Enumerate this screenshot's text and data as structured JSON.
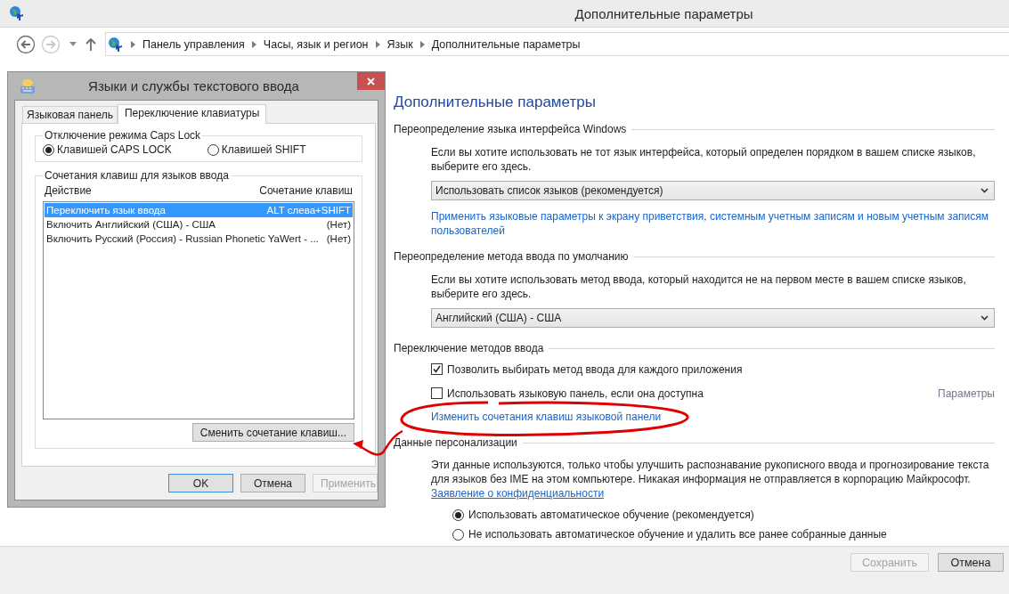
{
  "window": {
    "title": "Дополнительные параметры"
  },
  "nav": [
    {
      "kind": "back",
      "disabled": false
    },
    {
      "kind": "forward",
      "disabled": true
    },
    {
      "kind": "history"
    },
    {
      "kind": "up"
    }
  ],
  "breadcrumb": [
    "Панель управления",
    "Часы, язык и регион",
    "Язык",
    "Дополнительные параметры"
  ],
  "content": {
    "heading": "Дополнительные параметры",
    "sections": [
      {
        "title": "Переопределение языка интерфейса Windows",
        "items": [
          {
            "kind": "text",
            "text": "Если вы хотите использовать не тот язык интерфейса, который определен порядком в вашем списке языков, выберите его здесь."
          },
          {
            "kind": "select",
            "value": "Использовать список языков (рекомендуется)"
          },
          {
            "kind": "link",
            "text": "Применить языковые параметры к экрану приветствия, системным учетным записям и новым учетным записям пользователей",
            "underlined": false
          }
        ]
      },
      {
        "title": "Переопределение метода ввода по умолчанию",
        "items": [
          {
            "kind": "text",
            "text": "Если вы хотите использовать метод ввода, который находится не на первом месте в вашем списке языков, выберите его здесь."
          },
          {
            "kind": "select",
            "value": "Английский (США) - США"
          }
        ]
      },
      {
        "title": "Переключение методов ввода",
        "items": [
          {
            "kind": "checkbox",
            "label": "Позволить выбирать метод ввода для каждого приложения",
            "checked": true
          },
          {
            "kind": "checkbox",
            "label": "Использовать языковую панель, если она доступна",
            "checked": false,
            "action": "Параметры"
          },
          {
            "kind": "link",
            "text": "Изменить сочетания клавиш языковой панели",
            "underlined": false
          }
        ]
      },
      {
        "title": "Данные персонализации",
        "items": [
          {
            "kind": "text",
            "text": "Эти данные используются, только чтобы улучшить распознавание рукописного ввода и прогнозирование текста для языков без IME на этом компьютере. Никакая информация не отправляется в корпорацию Майкрософт."
          },
          {
            "kind": "link",
            "text": "Заявление о конфиденциальности",
            "underlined": true
          },
          {
            "kind": "radio",
            "label": "Использовать автоматическое обучение (рекомендуется)",
            "selected": true
          },
          {
            "kind": "radio",
            "label": "Не использовать автоматическое обучение и удалить все ранее собранные данные",
            "selected": false
          }
        ]
      }
    ]
  },
  "footer_buttons": [
    {
      "label": "Сохранить",
      "disabled": true
    },
    {
      "label": "Отмена",
      "disabled": false
    }
  ],
  "dialog": {
    "title": "Языки и службы текстового ввода",
    "tabs": [
      {
        "label": "Языковая панель",
        "selected": false
      },
      {
        "label": "Переключение клавиатуры",
        "selected": true
      }
    ],
    "caps_lock": {
      "legend": "Отключение режима Caps Lock",
      "options": [
        {
          "label": "Клавишей CAPS LOCK",
          "selected": true
        },
        {
          "label": "Клавишей SHIFT",
          "selected": false
        }
      ]
    },
    "hotkeys": {
      "legend": "Сочетания клавиш для языков ввода",
      "columns": [
        "Действие",
        "Сочетание клавиш"
      ],
      "rows": [
        {
          "action": "Переключить язык ввода",
          "keys": "ALT слева+SHIFT",
          "selected": true
        },
        {
          "action": "Включить Английский (США) - США",
          "keys": "(Нет)",
          "selected": false
        },
        {
          "action": "Включить Русский (Россия) - Russian Phonetic YaWert - ...",
          "keys": "(Нет)",
          "selected": false
        }
      ],
      "change_button": "Сменить сочетание клавиш..."
    },
    "buttons": [
      {
        "label": "OK",
        "kind": "default",
        "disabled": false
      },
      {
        "label": "Отмена",
        "kind": "normal",
        "disabled": false
      },
      {
        "label": "Применить",
        "kind": "normal",
        "disabled": true
      }
    ]
  }
}
